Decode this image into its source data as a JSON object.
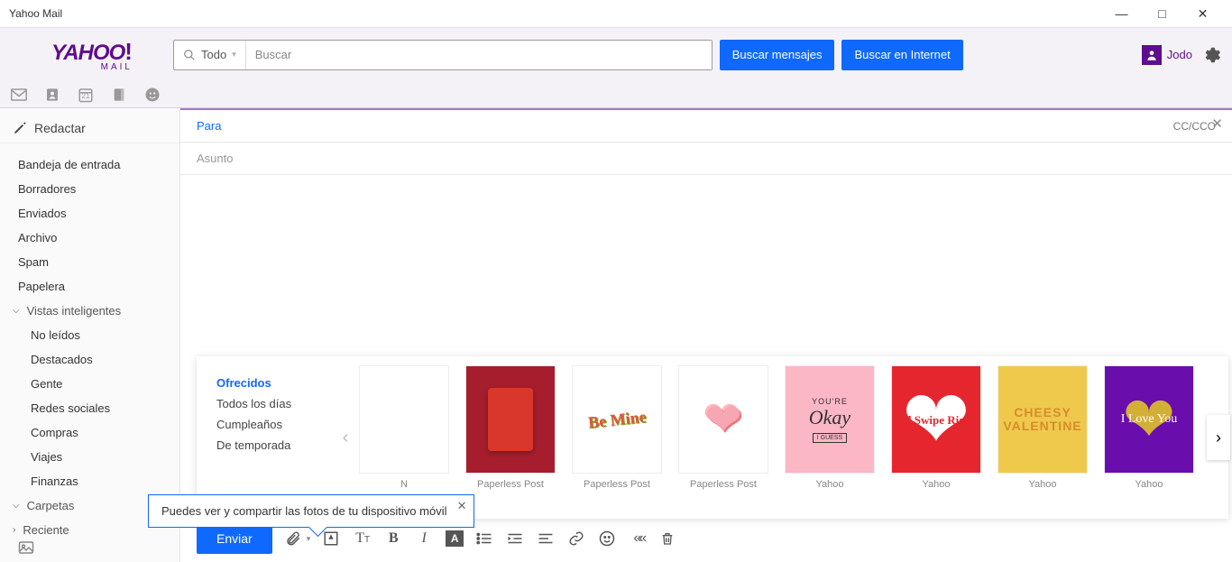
{
  "window": {
    "title": "Yahoo Mail"
  },
  "logo": {
    "brand": "YAHOO",
    "bang": "!",
    "sub": "MAIL"
  },
  "search": {
    "scope": "Todo",
    "placeholder": "Buscar",
    "btn_messages": "Buscar mensajes",
    "btn_web": "Buscar en Internet"
  },
  "user": {
    "name": "Jodo"
  },
  "compose_btn": "Redactar",
  "folders": {
    "items": [
      "Bandeja de entrada",
      "Borradores",
      "Enviados",
      "Archivo",
      "Spam",
      "Papelera"
    ]
  },
  "smart": {
    "header": "Vistas inteligentes",
    "items": [
      "No leídos",
      "Destacados",
      "Gente",
      "Redes sociales",
      "Compras",
      "Viajes",
      "Finanzas"
    ]
  },
  "sections": {
    "carpetas": "Carpetas",
    "reciente": "Reciente"
  },
  "compose": {
    "to_label": "Para",
    "cc": "CC/CCO",
    "subject_placeholder": "Asunto",
    "send": "Enviar"
  },
  "tooltip": {
    "text": "Puedes ver y compartir las fotos de tu dispositivo móvil"
  },
  "stationery": {
    "cats": {
      "active": "Ofrecidos",
      "c1": "Todos los días",
      "c2": "Cumpleaños",
      "c3": "De temporada"
    },
    "cards": [
      {
        "caption": "N",
        "art": {
          "kind": "blank"
        }
      },
      {
        "caption": "Paperless Post",
        "art": {
          "kind": "red-envelope"
        }
      },
      {
        "caption": "Paperless Post",
        "art": {
          "kind": "be-mine",
          "text": "Be Mine"
        }
      },
      {
        "caption": "Paperless Post",
        "art": {
          "kind": "rose-heart"
        }
      },
      {
        "caption": "Yahoo",
        "art": {
          "kind": "okay",
          "l1": "YOU'RE",
          "l2": "Okay",
          "l3": "I GUESS"
        }
      },
      {
        "caption": "Yahoo",
        "art": {
          "kind": "swipe",
          "text": "I'd Swipe Right"
        }
      },
      {
        "caption": "Yahoo",
        "art": {
          "kind": "cheesy",
          "l1": "CHEESY",
          "l2": "VALENTINE"
        }
      },
      {
        "caption": "Yahoo",
        "art": {
          "kind": "iloveyou",
          "text": "I Love You"
        }
      }
    ]
  },
  "iconstrip_cal": "21"
}
